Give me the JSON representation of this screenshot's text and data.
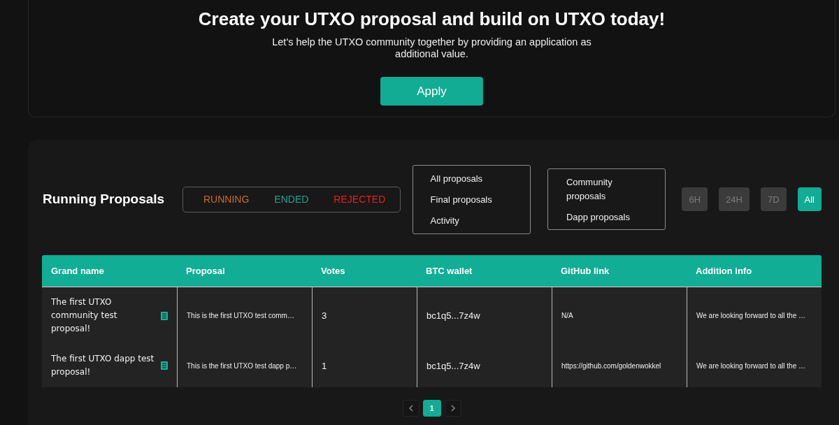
{
  "hero": {
    "title": "Create your UTXO proposal and build on UTXO today!",
    "subtitle": "Let's help the UTXO community together by providing an application as additional value.",
    "apply_button": "Apply"
  },
  "proposals": {
    "heading": "Running Proposals",
    "status_filters": [
      {
        "label": "RUNNING",
        "color": "#c96a2e"
      },
      {
        "label": "ENDED",
        "color": "#1fa48f"
      },
      {
        "label": "REJECTED",
        "color": "#e3211f"
      }
    ],
    "view_menu": {
      "items": [
        "All proposals",
        "Final proposals",
        "Activity"
      ]
    },
    "type_menu": {
      "items": [
        "Community proposals",
        "Dapp proposals"
      ]
    },
    "time_filters": [
      {
        "label": "6H",
        "selected": false
      },
      {
        "label": "24H",
        "selected": false
      },
      {
        "label": "7D",
        "selected": false
      },
      {
        "label": "All",
        "selected": true
      }
    ],
    "table": {
      "columns": [
        "Grand name",
        "Proposal",
        "Votes",
        "BTC wallet",
        "GitHub link",
        "Addition info"
      ],
      "rows": [
        {
          "cells": [
            "The first UTXO community test proposal!",
            "This is the first UTXO test comm…",
            "3",
            "bc1q5...7z4w",
            "N/A",
            "We are looking forward to all the …"
          ]
        },
        {
          "cells": [
            "The first UTXO dapp test proposal!",
            "This is the first UTXO test dapp p…",
            "1",
            "bc1q5...7z4w",
            "https://github.com/goldenwokkel",
            "We are looking forward to all the …"
          ]
        }
      ]
    },
    "pagination": {
      "pages": [
        {
          "label": "1",
          "selected": true
        }
      ]
    }
  }
}
